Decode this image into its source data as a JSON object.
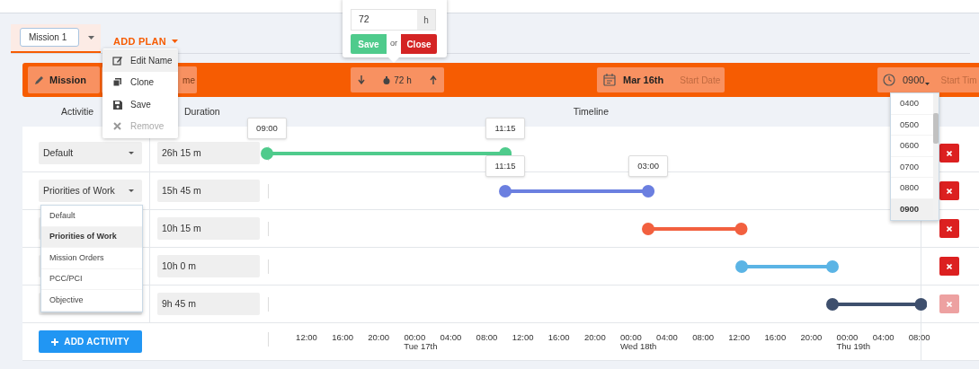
{
  "plan_tab": {
    "name": "Mission 1"
  },
  "add_plan": "ADD PLAN",
  "plan_menu": [
    {
      "kind": "edit",
      "label": "Edit Name",
      "highlighted": true,
      "disabled": false
    },
    {
      "kind": "clone",
      "label": "Clone",
      "highlighted": false,
      "disabled": false
    },
    {
      "kind": "save",
      "label": "Save",
      "highlighted": false,
      "disabled": false
    },
    {
      "kind": "remove",
      "label": "Remove",
      "highlighted": false,
      "disabled": true
    }
  ],
  "duration_popover": {
    "value": "72",
    "unit": "h",
    "save": "Save",
    "or": "or",
    "close": "Close"
  },
  "mission_bar": {
    "mission": "Mission",
    "name_field": "me",
    "duration": "72 h",
    "start_date": "Mar 16th",
    "start_date_label": "Start Date",
    "start_time": "0900",
    "start_time_label": "Start Tim"
  },
  "columns": [
    "Activitie",
    "Duration",
    "Timeline"
  ],
  "activities": [
    {
      "type": "Default",
      "duration": "26h 15 m",
      "color": "#4fcb8c",
      "start_label": "09:00",
      "end_label": "11:15",
      "delete_disabled": false
    },
    {
      "type": "Priorities of Work",
      "duration": "15h 45 m",
      "color": "#6b7fe0",
      "start_label": "11:15",
      "end_label": "03:00",
      "delete_disabled": false
    },
    {
      "duration": "10h 15 m",
      "color": "#f2603f",
      "delete_disabled": false
    },
    {
      "duration": "10h 0 m",
      "color": "#5bb4e5",
      "delete_disabled": false
    },
    {
      "duration": "9h 45 m",
      "color": "#3e4f6d",
      "delete_disabled": true
    }
  ],
  "type_dropdown": [
    {
      "label": "Default",
      "selected": false
    },
    {
      "label": "Priorities of Work",
      "selected": true
    },
    {
      "label": "Mission Orders",
      "selected": false
    },
    {
      "label": "PCC/PCI",
      "selected": false
    },
    {
      "label": "Objective",
      "selected": false
    }
  ],
  "time_dropdown": [
    {
      "label": "0400",
      "selected": false
    },
    {
      "label": "0500",
      "selected": false
    },
    {
      "label": "0600",
      "selected": false
    },
    {
      "label": "0700",
      "selected": false
    },
    {
      "label": "0800",
      "selected": false
    },
    {
      "label": "0900",
      "selected": true
    }
  ],
  "add_activity": "ADD ACTIVITY",
  "axis": [
    {
      "time": "12:00"
    },
    {
      "time": "16:00"
    },
    {
      "time": "20:00"
    },
    {
      "time": "00:00",
      "day": "Tue 17th"
    },
    {
      "time": "04:00"
    },
    {
      "time": "08:00"
    },
    {
      "time": "12:00"
    },
    {
      "time": "16:00"
    },
    {
      "time": "20:00"
    },
    {
      "time": "00:00",
      "day": "Wed 18th"
    },
    {
      "time": "04:00"
    },
    {
      "time": "08:00"
    },
    {
      "time": "12:00"
    },
    {
      "time": "16:00"
    },
    {
      "time": "20:00"
    },
    {
      "time": "00:00",
      "day": "Thu 19th"
    },
    {
      "time": "04:00"
    },
    {
      "time": "08:00"
    }
  ]
}
